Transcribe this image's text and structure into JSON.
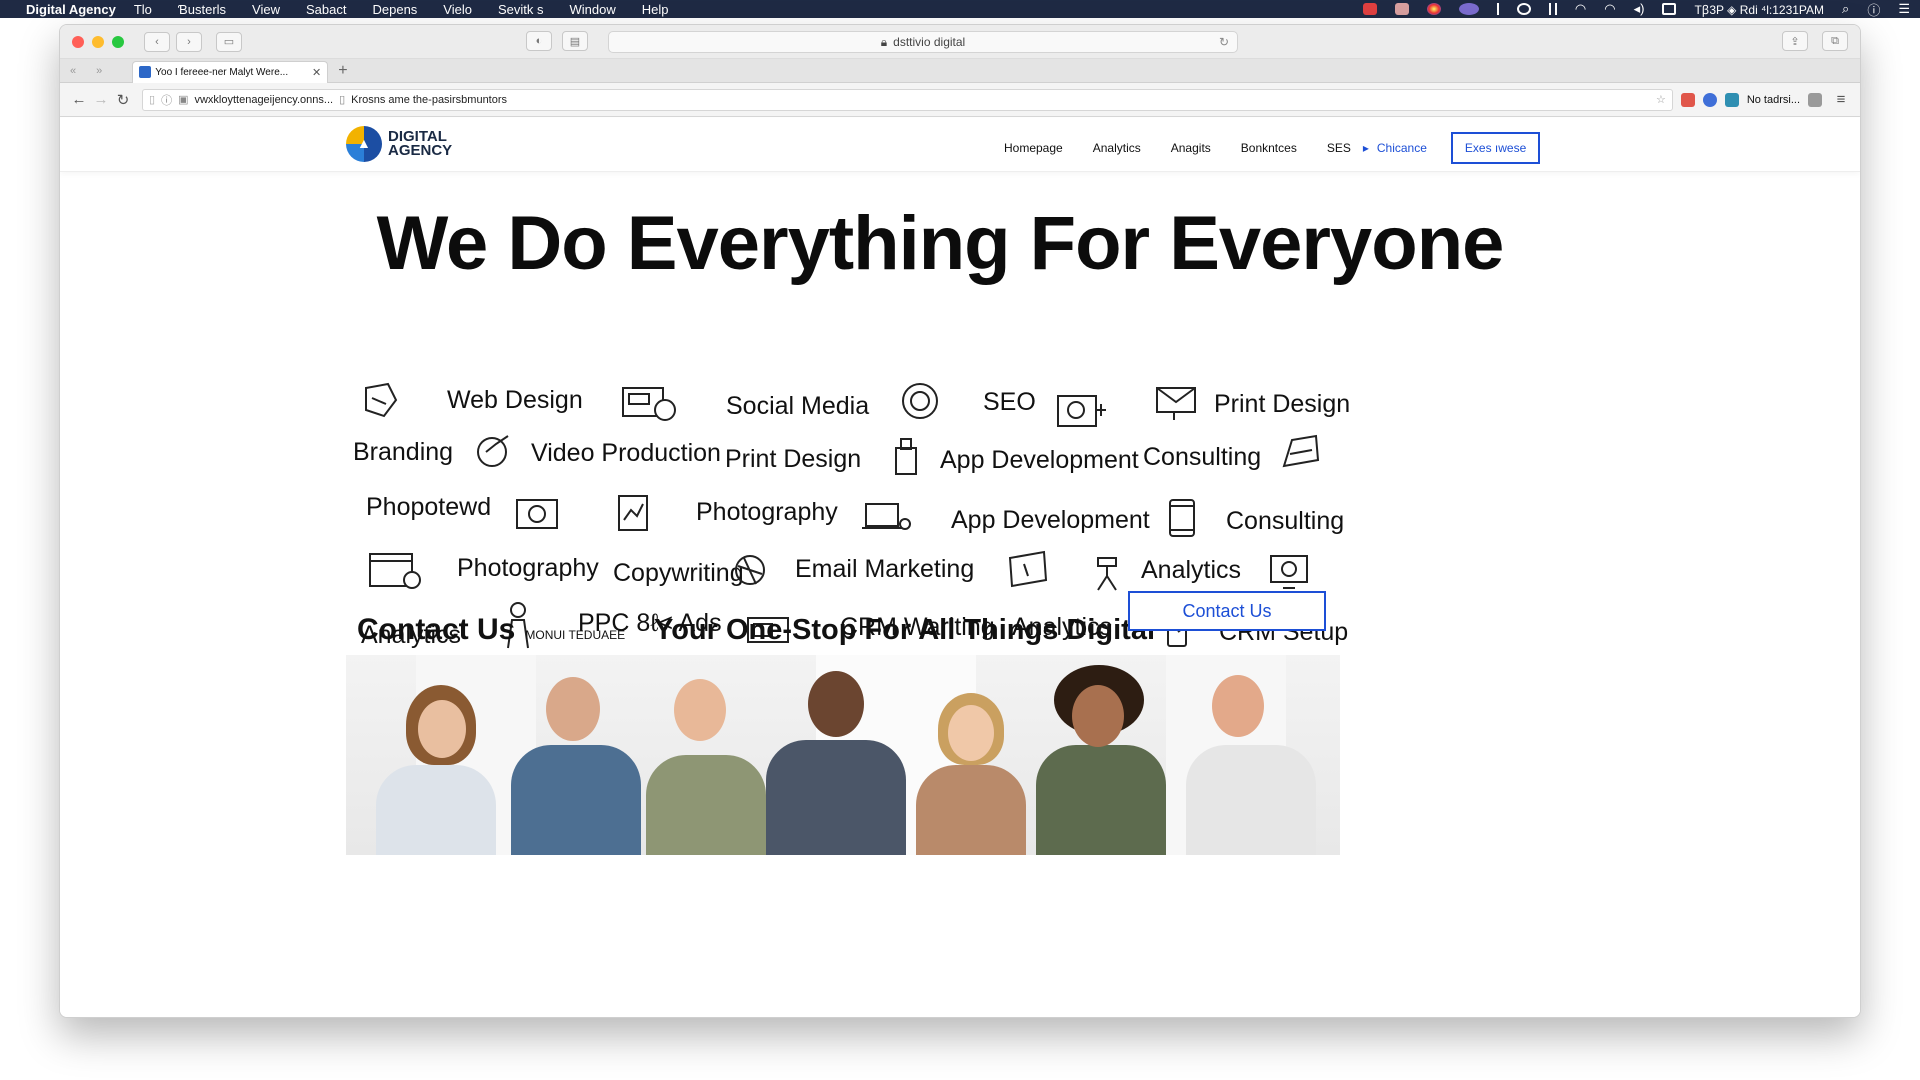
{
  "menubar": {
    "app": "Digital Agency",
    "items": [
      "Tlo",
      "Ɓusterls",
      "View",
      "Sabact",
      "Depens",
      "Vielo",
      "Sevitk s",
      "Window",
      "Help"
    ],
    "clock": "Tꞵ3P ◈ Rdi ⁴l:1231PAM"
  },
  "browser": {
    "title_address": "dsttivio digital",
    "tab_title": "Yoo I fereee-ner Malyt Were...",
    "url": "vwxkloyttenageijency.onns...",
    "url_suffix": "Krosns ame the-pasirsbmuntors",
    "ext_label": "No tadrsi..."
  },
  "site": {
    "logo_line1": "DIGITAL",
    "logo_line2": "AGENCY",
    "nav": [
      "Homepage",
      "Analytics",
      "Anagits",
      "Bonkntces",
      "SES"
    ],
    "nav_active": "Chicance",
    "nav_cta": "Exes ıwese"
  },
  "hero": {
    "title": "We Do Everything For Everyone"
  },
  "services": {
    "r1": [
      "Web Design",
      "Social Media",
      "SEO",
      "Print Design"
    ],
    "r2": [
      "Branding",
      "Video Production",
      "Print Design",
      "App Development",
      "Consulting"
    ],
    "r3": [
      "Phopotewd",
      "Photography",
      "App Development",
      "Consulting"
    ],
    "r4": [
      "Photography",
      "Copywriting",
      "Email Marketing",
      "Analytics"
    ],
    "r5": [
      "Analytics",
      "PPC 8ℓ< Ads",
      "CRM Wariting",
      "Analytics",
      "CRM Setup"
    ]
  },
  "contact": {
    "heading": "Contact Us",
    "small": "MONUI TEDUAEE",
    "tagline": "Your One-Stop For All Things Digital",
    "button": "Contact Us"
  },
  "colors": {
    "accent": "#1d4fd6",
    "menubar": "#1f2a44"
  },
  "icons": [
    "web-design-icon",
    "social-media-icon",
    "seo-icon",
    "camera-icon",
    "print-design-icon",
    "video-icon",
    "app-icon",
    "consulting-icon",
    "photo-icon",
    "laptop-icon",
    "tablet-icon",
    "browser-settings-icon",
    "email-icon",
    "analytics-icon",
    "monitor-icon",
    "ppc-icon",
    "crm-icon",
    "crm-setup-icon"
  ]
}
